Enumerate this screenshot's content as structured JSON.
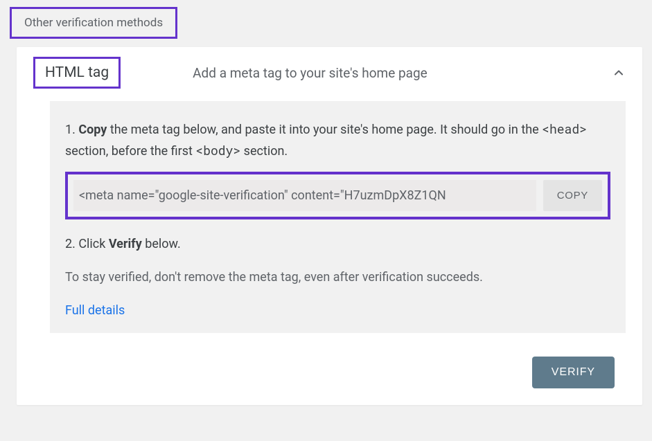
{
  "section_header": "Other verification methods",
  "accordion": {
    "method_name": "HTML tag",
    "description": "Add a meta tag to your site's home page"
  },
  "instructions": {
    "step1_prefix": "1. ",
    "step1_bold": "Copy",
    "step1_text_a": " the meta tag below, and paste it into your site's home page. It should go in the ",
    "step1_code_a": "<head>",
    "step1_text_b": " section, before the first ",
    "step1_code_b": "<body>",
    "step1_text_c": " section.",
    "meta_tag_value": "<meta name=\"google-site-verification\" content=\"H7uzmDpX8Z1QN",
    "copy_label": "COPY",
    "step2_prefix": "2. Click ",
    "step2_bold": "Verify",
    "step2_text": " below.",
    "note": "To stay verified, don't remove the meta tag, even after verification succeeds.",
    "link_label": "Full details"
  },
  "actions": {
    "verify_label": "VERIFY"
  }
}
